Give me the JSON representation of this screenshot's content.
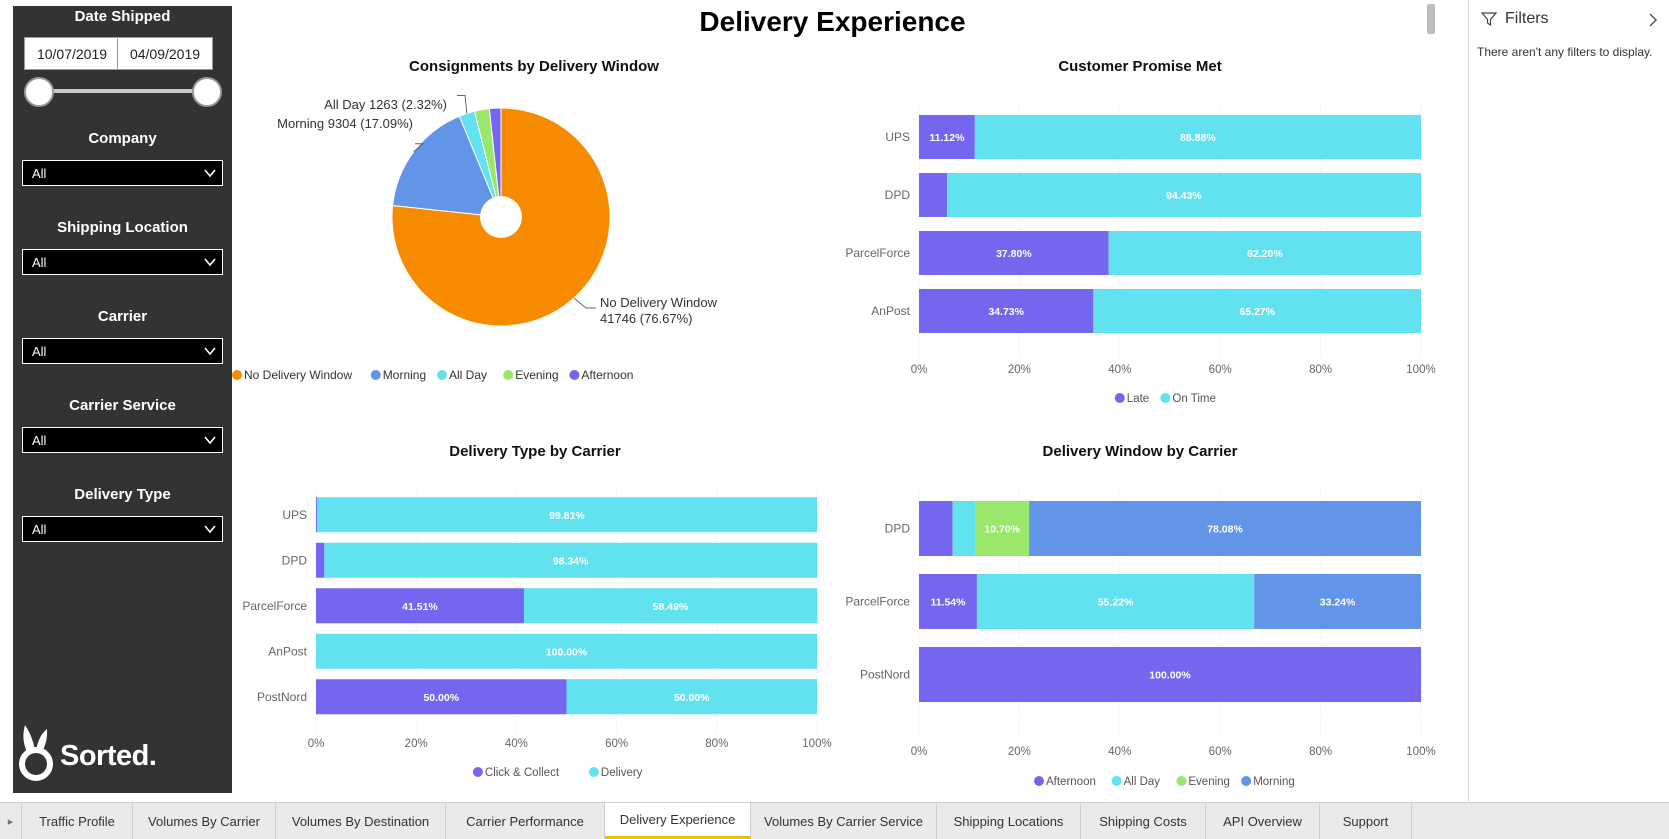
{
  "page": {
    "title": "Delivery Experience"
  },
  "sidebar": {
    "date_shipped": {
      "title": "Date Shipped",
      "start": "10/07/2019",
      "end": "04/09/2019"
    },
    "slicers": [
      {
        "title": "Company",
        "value": "All"
      },
      {
        "title": "Shipping Location",
        "value": "All"
      },
      {
        "title": "Carrier",
        "value": "All"
      },
      {
        "title": "Carrier Service",
        "value": "All"
      },
      {
        "title": "Delivery Type",
        "value": "All"
      }
    ],
    "logo_text": "Sorted."
  },
  "filters_pane": {
    "title": "Filters",
    "empty_message": "There aren't any filters to display."
  },
  "tabs": [
    {
      "label": "Traffic Profile"
    },
    {
      "label": "Volumes By Carrier"
    },
    {
      "label": "Volumes By Destination"
    },
    {
      "label": "Carrier Performance"
    },
    {
      "label": "Delivery Experience",
      "active": true
    },
    {
      "label": "Volumes By Carrier Service"
    },
    {
      "label": "Shipping Locations"
    },
    {
      "label": "Shipping Costs"
    },
    {
      "label": "API Overview"
    },
    {
      "label": "Support"
    }
  ],
  "colors": {
    "no_window": "#F68B00",
    "morning": "#6295E8",
    "all_day": "#62E2EE",
    "evening": "#99E86B",
    "afternoon": "#7466EE",
    "late": "#7466EE",
    "on_time": "#62E2EE",
    "click_collect": "#7466EE",
    "delivery": "#62E2EE"
  },
  "chart_data": [
    {
      "type": "pie",
      "title": "Consignments by Delivery Window",
      "slices": [
        {
          "name": "No Delivery Window",
          "value": 41746,
          "label": "No Delivery Window",
          "label2": "41746 (76.67%)",
          "color_key": "no_window"
        },
        {
          "name": "Morning",
          "value": 9304,
          "label": "Morning 9304 (17.09%)",
          "color_key": "morning"
        },
        {
          "name": "All Day",
          "value": 1263,
          "label": "All Day 1263 (2.32%)",
          "color_key": "all_day"
        },
        {
          "name": "Evening",
          "value": 1200,
          "color_key": "evening"
        },
        {
          "name": "Afternoon",
          "value": 930,
          "color_key": "afternoon"
        }
      ],
      "legend": [
        "No Delivery Window",
        "Morning",
        "All Day",
        "Evening",
        "Afternoon"
      ]
    },
    {
      "type": "bar",
      "stacked": "100%",
      "title": "Customer Promise Met",
      "categories": [
        "UPS",
        "DPD",
        "ParcelForce",
        "AnPost"
      ],
      "series": [
        {
          "name": "Late",
          "values": [
            11.12,
            5.57,
            37.8,
            34.73
          ],
          "labels": [
            "11.12%",
            "",
            "37.80%",
            "34.73%"
          ],
          "color_key": "late"
        },
        {
          "name": "On Time",
          "values": [
            88.88,
            94.43,
            62.2,
            65.27
          ],
          "labels": [
            "88.88%",
            "94.43%",
            "62.20%",
            "65.27%"
          ],
          "color_key": "on_time"
        }
      ],
      "xticks": [
        "0%",
        "20%",
        "40%",
        "60%",
        "80%",
        "100%"
      ]
    },
    {
      "type": "bar",
      "stacked": "100%",
      "title": "Delivery Type by Carrier",
      "categories": [
        "UPS",
        "DPD",
        "ParcelForce",
        "AnPost",
        "PostNord"
      ],
      "series": [
        {
          "name": "Click & Collect",
          "values": [
            0.19,
            1.66,
            41.51,
            0,
            50.0
          ],
          "labels": [
            "",
            "",
            "41.51%",
            "",
            "50.00%"
          ],
          "color_key": "click_collect"
        },
        {
          "name": "Delivery",
          "values": [
            99.81,
            98.34,
            58.49,
            100.0,
            50.0
          ],
          "labels": [
            "99.81%",
            "98.34%",
            "58.49%",
            "100.00%",
            "50.00%"
          ],
          "color_key": "delivery"
        }
      ],
      "xticks": [
        "0%",
        "20%",
        "40%",
        "60%",
        "80%",
        "100%"
      ]
    },
    {
      "type": "bar",
      "stacked": "100%",
      "title": "Delivery Window by Carrier",
      "categories": [
        "DPD",
        "ParcelForce",
        "PostNord"
      ],
      "series": [
        {
          "name": "Afternoon",
          "values": [
            6.7,
            11.54,
            100.0
          ],
          "labels": [
            "",
            "11.54%",
            "100.00%"
          ],
          "color_key": "afternoon"
        },
        {
          "name": "All Day",
          "values": [
            4.52,
            55.22,
            0
          ],
          "labels": [
            "",
            "55.22%",
            ""
          ],
          "color_key": "all_day"
        },
        {
          "name": "Evening",
          "values": [
            10.7,
            0,
            0
          ],
          "labels": [
            "10.70%",
            "",
            ""
          ],
          "color_key": "evening"
        },
        {
          "name": "Morning",
          "values": [
            78.08,
            33.24,
            0
          ],
          "labels": [
            "78.08%",
            "33.24%",
            ""
          ],
          "color_key": "morning"
        }
      ],
      "xticks": [
        "0%",
        "20%",
        "40%",
        "60%",
        "80%",
        "100%"
      ]
    }
  ]
}
